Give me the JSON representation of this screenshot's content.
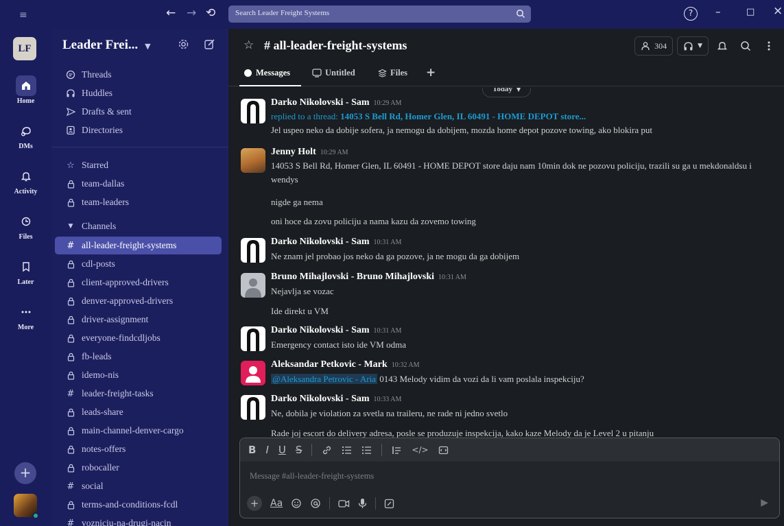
{
  "titlebar": {
    "search_placeholder": "Search Leader Freight Systems",
    "back_glyph": "←",
    "forward_glyph": "→",
    "history_glyph": "⟲",
    "help_glyph": "?",
    "minimize_glyph": "–",
    "maximize_glyph": "□",
    "close_glyph": "×"
  },
  "rail": {
    "workspace_initials": "LF",
    "items": [
      {
        "label": "Home",
        "icon": "home-icon"
      },
      {
        "label": "DMs",
        "icon": "dms-icon"
      },
      {
        "label": "Activity",
        "icon": "bell-icon"
      },
      {
        "label": "Files",
        "icon": "files-icon"
      },
      {
        "label": "Later",
        "icon": "bookmark-icon"
      },
      {
        "label": "More",
        "icon": "more-icon"
      }
    ],
    "add_glyph": "+"
  },
  "sidebar": {
    "workspace_name": "Leader Frei...",
    "nav": [
      {
        "label": "Threads",
        "icon": "threads-icon"
      },
      {
        "label": "Huddles",
        "icon": "headphones-icon"
      },
      {
        "label": "Drafts & sent",
        "icon": "send-icon"
      },
      {
        "label": "Directories",
        "icon": "directory-icon"
      }
    ],
    "starred": {
      "label": "Starred",
      "items": [
        "team-dallas",
        "team-leaders"
      ]
    },
    "channels": {
      "label": "Channels",
      "items": [
        {
          "name": "all-leader-freight-systems",
          "type": "public",
          "selected": true
        },
        {
          "name": "cdl-posts",
          "type": "private"
        },
        {
          "name": "client-approved-drivers",
          "type": "private"
        },
        {
          "name": "denver-approved-drivers",
          "type": "private"
        },
        {
          "name": "driver-assignment",
          "type": "private"
        },
        {
          "name": "everyone-findcdljobs",
          "type": "private"
        },
        {
          "name": "fb-leads",
          "type": "private"
        },
        {
          "name": "idemo-nis",
          "type": "private"
        },
        {
          "name": "leader-freight-tasks",
          "type": "public"
        },
        {
          "name": "leads-share",
          "type": "private"
        },
        {
          "name": "main-channel-denver-cargo",
          "type": "private"
        },
        {
          "name": "notes-offers",
          "type": "private"
        },
        {
          "name": "robocaller",
          "type": "private"
        },
        {
          "name": "social",
          "type": "public"
        },
        {
          "name": "terms-and-conditions-fcdl",
          "type": "private"
        },
        {
          "name": "vozniciu-na-drugi-nacin",
          "type": "public"
        }
      ]
    }
  },
  "channel": {
    "name": "# all-leader-freight-systems",
    "member_count": "304",
    "tabs": [
      {
        "label": "Messages",
        "active": true
      },
      {
        "label": "Untitled"
      },
      {
        "label": "Files"
      }
    ],
    "today_label": "Today"
  },
  "messages": [
    {
      "author": "Darko Nikolovski - Sam",
      "time": "10:29 AM",
      "reply_prefix": "replied to a thread:",
      "reply_thread": "14053 S Bell Rd, Homer Glen, IL 60491 - HOME DEPOT store...",
      "text": "Jel uspeo neko da dobije sofera, ja nemogu da dobijem, mozda home depot pozove towing, ako blokira put"
    },
    {
      "author": "Jenny Holt",
      "time": "10:29 AM",
      "text": "14053 S Bell Rd, Homer Glen, IL 60491 - HOME DEPOT store daju nam 10min dok ne pozovu policiju, trazili su ga u mekdonaldsu i wendys",
      "followups": [
        "nigde ga nema",
        "oni hoce da zovu policiju  a nama kazu da zovemo towing"
      ]
    },
    {
      "author": "Darko Nikolovski - Sam",
      "time": "10:31 AM",
      "text": "Ne znam jel probao jos neko da ga pozove, ja ne mogu da ga dobijem"
    },
    {
      "author": "Bruno Mihajlovski - Bruno Mihajlovski",
      "time": "10:31 AM",
      "text": "Nejavlja se vozac",
      "followups": [
        "Ide direkt u VM"
      ]
    },
    {
      "author": "Darko Nikolovski - Sam",
      "time": "10:31 AM",
      "text": "Emergency contact isto ide VM odma"
    },
    {
      "author": "Aleksandar Petkovic - Mark",
      "time": "10:32 AM",
      "mention": "@Aleksandra Petrovic - Aria",
      "text": " 0143 Melody vidim da vozi da li vam poslala inspekciju?"
    },
    {
      "author": "Darko Nikolovski - Sam",
      "time": "10:33 AM",
      "text": "Ne, dobila je violation za svetla na traileru, ne rade ni jedno svetlo",
      "followups": [
        "Rade joj escort do delivery adresa, posle se produzuje inspekcija, kako kaze Melody da je Level 2 u pitanju"
      ]
    }
  ],
  "composer": {
    "placeholder": "Message #all-leader-freight-systems",
    "format_buttons": [
      "B",
      "I",
      "U",
      "S"
    ],
    "aa_label": "Aa"
  },
  "colors": {
    "sidebar_bg": "#1c1f5e",
    "rail_bg": "#1a1d5c",
    "selected_channel": "#4a50a8",
    "main_bg": "#1a1d21",
    "link": "#1d9bd1"
  }
}
